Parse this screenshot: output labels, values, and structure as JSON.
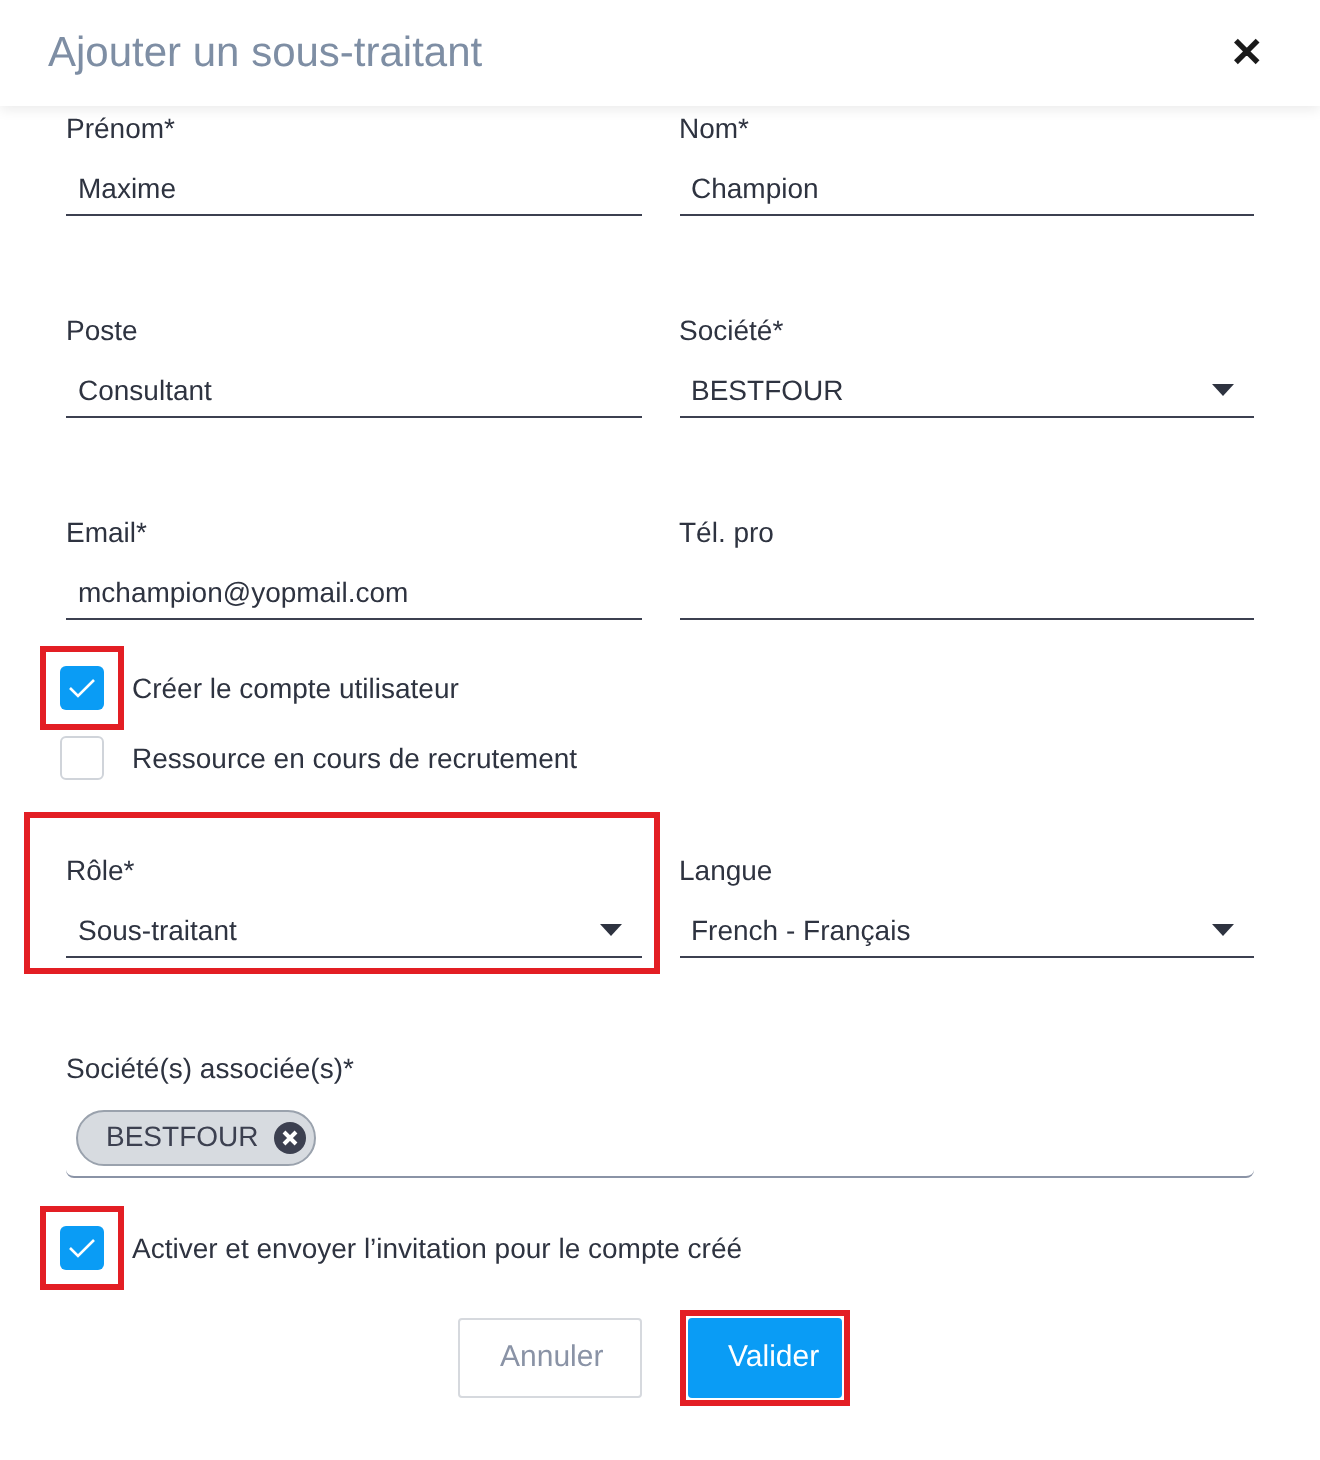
{
  "dialog": {
    "title": "Ajouter un sous-traitant",
    "close": "✕"
  },
  "fields": [
    {
      "label": "Prénom*",
      "value": "Maxime",
      "kind": "text",
      "highlighted": false
    },
    {
      "label": "Nom*",
      "value": "Champion",
      "kind": "text",
      "highlighted": false
    },
    {
      "label": "Poste",
      "value": "Consultant",
      "kind": "text",
      "highlighted": false
    },
    {
      "label": "Société*",
      "value": "BESTFOUR",
      "kind": "select",
      "highlighted": false
    },
    {
      "label": "Email*",
      "value": "mchampion@yopmail.com",
      "kind": "text",
      "highlighted": false
    },
    {
      "label": "Tél. pro",
      "kind": "text",
      "highlighted": false
    }
  ],
  "checkboxes": [
    {
      "label": "Créer le compte utilisateur",
      "checked": true,
      "highlighted": true
    },
    {
      "label": "Ressource en cours de recrutement",
      "checked": false,
      "highlighted": false
    }
  ],
  "fields2": [
    {
      "label": "Rôle*",
      "value": "Sous-traitant",
      "kind": "select",
      "highlighted": true
    },
    {
      "label": "Langue",
      "value": "French - Français",
      "kind": "select",
      "highlighted": false
    }
  ],
  "associated": {
    "label": "Société(s) associée(s)*",
    "chips": [
      "BESTFOUR"
    ]
  },
  "invite": {
    "label": "Activer et envoyer l’invitation pour le compte créé",
    "checked": true,
    "highlighted": true
  },
  "buttons": [
    {
      "label": "Annuler",
      "kind": "secondary",
      "highlighted": false
    },
    {
      "label": "Valider",
      "kind": "primary",
      "highlighted": true
    }
  ]
}
